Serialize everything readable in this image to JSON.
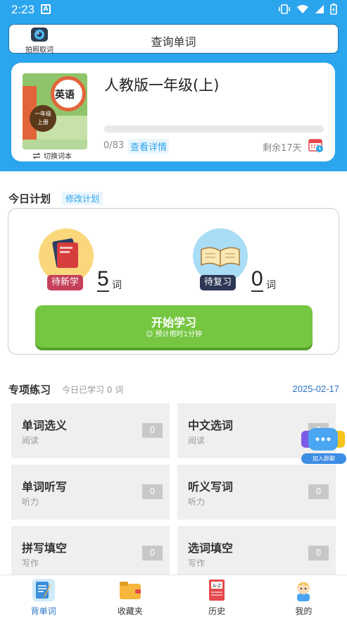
{
  "status": {
    "time": "2:23"
  },
  "search": {
    "camera_label": "拍照取词",
    "label": "查询单词"
  },
  "book": {
    "cover_title": "英语",
    "cover_grade_1": "一年级",
    "cover_grade_2": "上册",
    "switch_label": "切换词本",
    "title": "人教版一年级(上)",
    "progress": 0,
    "progress_text": "0/83",
    "detail_link": "查看详情",
    "remaining": "剩余17天"
  },
  "plan": {
    "title": "今日计划",
    "edit": "修改计划",
    "new_tag": "待新学",
    "new_count": "5",
    "review_tag": "待复习",
    "review_count": "0",
    "unit": "词",
    "start_label": "开始学习",
    "start_sub": "预计用时1分钟"
  },
  "practice": {
    "title": "专项练习",
    "subtitle": "今日已学习 0 词",
    "date": "2025-02-17",
    "tiles": [
      {
        "title": "单词选义",
        "sub": "阅读",
        "count": "0"
      },
      {
        "title": "中文选词",
        "sub": "阅读",
        "count": "0"
      },
      {
        "title": "单词听写",
        "sub": "听力",
        "count": "0"
      },
      {
        "title": "听义写词",
        "sub": "听力",
        "count": "0"
      },
      {
        "title": "拼写填空",
        "sub": "写作",
        "count": "0"
      },
      {
        "title": "选词填空",
        "sub": "写作",
        "count": "0"
      }
    ]
  },
  "float": {
    "chat_label": "加入群聊"
  },
  "nav": [
    {
      "label": "背单词"
    },
    {
      "label": "收藏夹"
    },
    {
      "label": "历史"
    },
    {
      "label": "我的"
    }
  ],
  "colors": {
    "accent": "#2ba5ee",
    "start": "#76c641",
    "link": "#2b74c8"
  }
}
